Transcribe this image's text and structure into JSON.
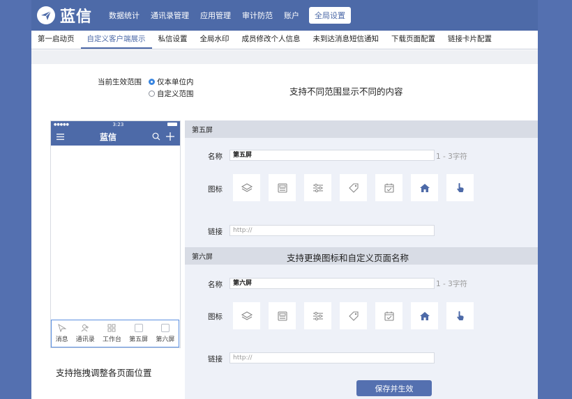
{
  "app": {
    "logo_text": "蓝信"
  },
  "topnav": [
    {
      "label": "数据统计"
    },
    {
      "label": "通讯录管理"
    },
    {
      "label": "应用管理"
    },
    {
      "label": "审计防范"
    },
    {
      "label": "账户"
    },
    {
      "label": "全局设置",
      "active": true
    }
  ],
  "subnav": [
    {
      "label": "第一启动页"
    },
    {
      "label": "自定义客户端展示",
      "active": true
    },
    {
      "label": "私信设置"
    },
    {
      "label": "全局水印"
    },
    {
      "label": "成员修改个人信息"
    },
    {
      "label": "未到达消息短信通知"
    },
    {
      "label": "下载页面配置"
    },
    {
      "label": "链接卡片配置"
    }
  ],
  "scope": {
    "label": "当前生效范围",
    "options": [
      {
        "label": "仅本单位内",
        "selected": true
      },
      {
        "label": "自定义范围",
        "selected": false
      }
    ]
  },
  "annotations": {
    "scope_note": "支持不同范围显示不同的内容",
    "icon_note": "支持更换图标和自定义页面名称",
    "drag_note": "支持拖拽调整各页面位置"
  },
  "phone": {
    "time": "3:23",
    "dots": "●●●●●",
    "title": "蓝信",
    "tabs": [
      {
        "label": "消息",
        "icon": "send-icon"
      },
      {
        "label": "通讯录",
        "icon": "contacts-icon"
      },
      {
        "label": "工作台",
        "icon": "grid-icon"
      },
      {
        "label": "第五屏",
        "icon": "blank-square-icon"
      },
      {
        "label": "第六屏",
        "icon": "blank-square-icon"
      }
    ]
  },
  "screen5": {
    "title": "第五屏",
    "name_label": "名称",
    "name_value": "第五屏",
    "name_hint": "1 - 3字符",
    "icon_label": "图标",
    "link_label": "链接",
    "link_placeholder": "http://"
  },
  "screen6": {
    "title": "第六屏",
    "name_label": "名称",
    "name_value": "第六屏",
    "name_hint": "1 - 3字符",
    "icon_label": "图标",
    "link_label": "链接",
    "link_placeholder": "http://"
  },
  "icon_options": [
    "layers-icon",
    "newspaper-icon",
    "sliders-icon",
    "tag-icon",
    "calendar-check-icon",
    "home-icon",
    "pointer-hand-icon"
  ],
  "save_button": "保存并生效",
  "colors": {
    "brand": "#4d6aa8",
    "accent": "#3a86e0"
  }
}
